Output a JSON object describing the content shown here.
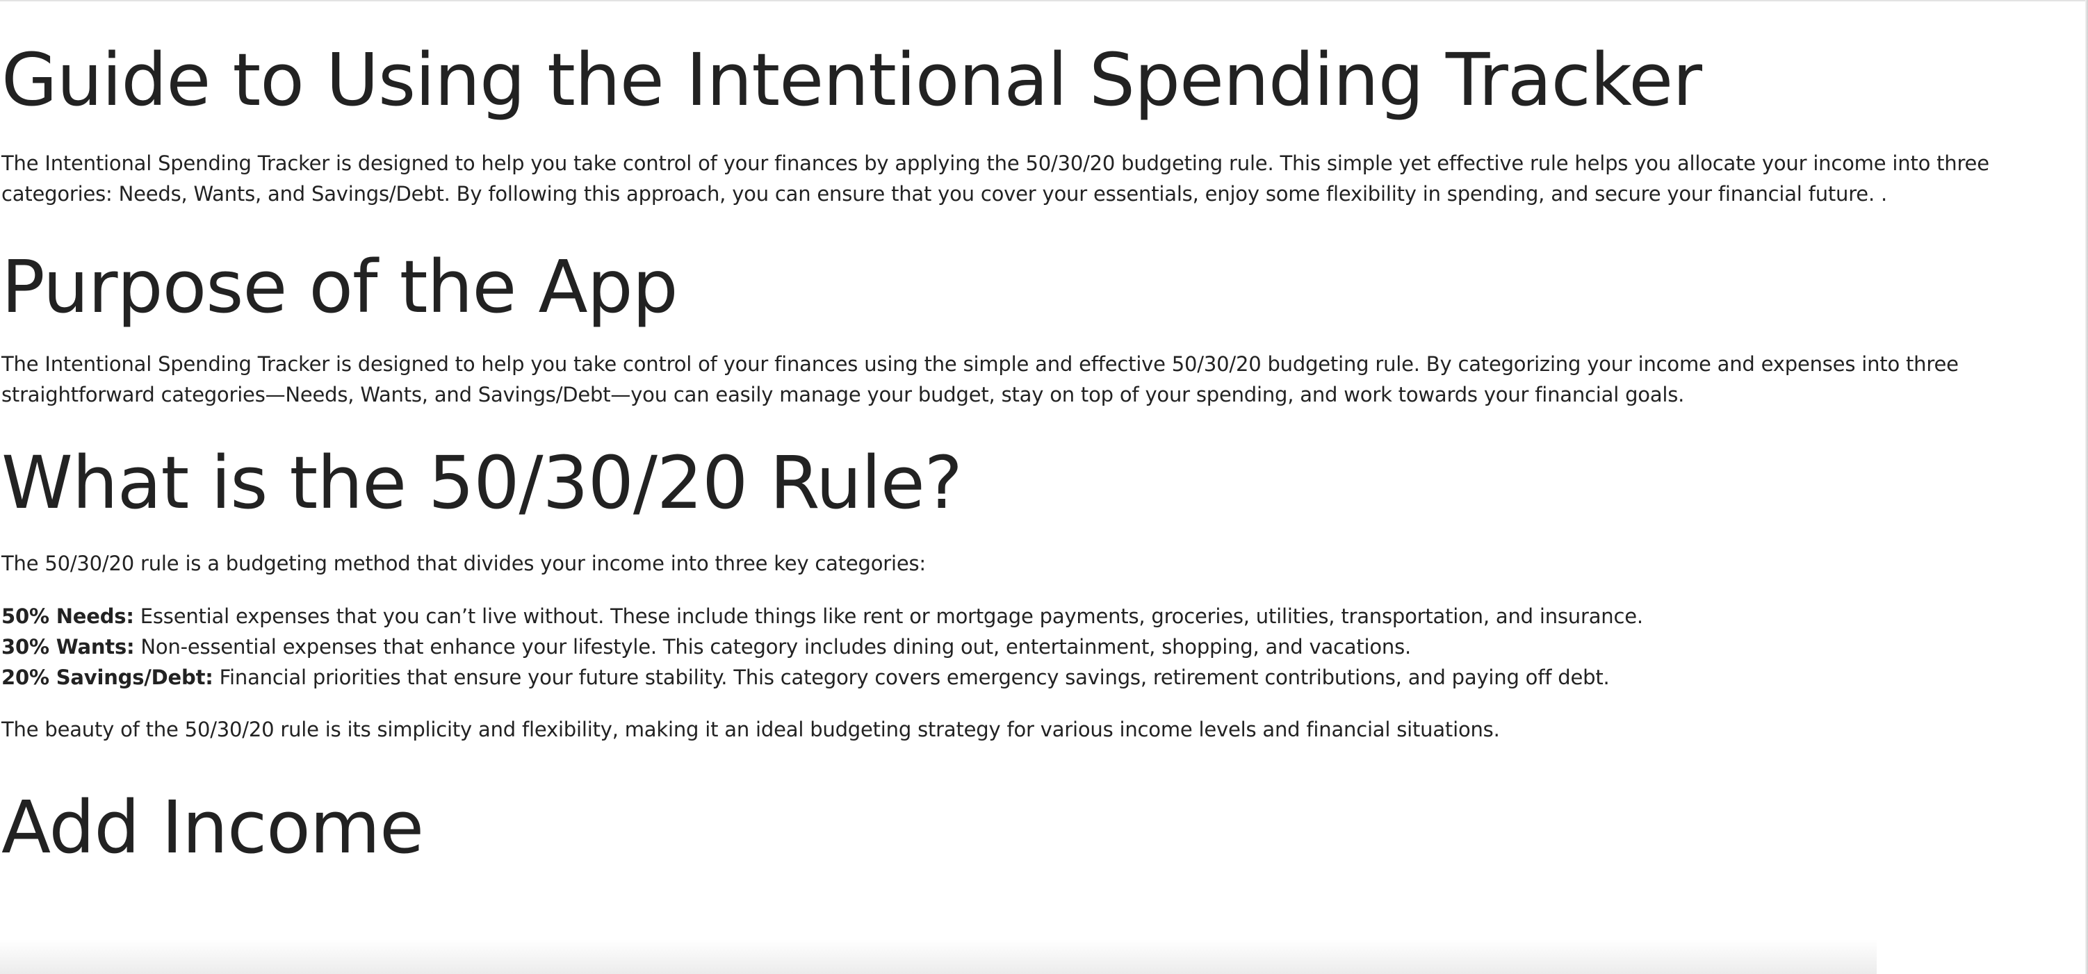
{
  "sections": [
    {
      "title": "Guide to Using the Intentional Spending Tracker",
      "paragraph": "The Intentional Spending Tracker is designed to help you take control of your finances by applying the 50/30/20 budgeting rule. This simple yet effective rule helps you allocate your income into three categories: Needs, Wants, and Savings/Debt. By following this approach, you can ensure that you cover your essentials, enjoy some flexibility in spending, and secure your financial future. ."
    },
    {
      "title": "Purpose of the App",
      "paragraph": "The Intentional Spending Tracker is designed to help you take control of your finances using the simple and effective 50/30/20 budgeting rule. By categorizing your income and expenses into three straightforward categories—Needs, Wants, and Savings/Debt—you can easily manage your budget, stay on top of your spending, and work towards your financial goals."
    },
    {
      "title": "What is the 50/30/20 Rule?",
      "intro": "The 50/30/20 rule is a budgeting method that divides your income into three key categories:",
      "rules": [
        {
          "label": "50% Needs:",
          "text": " Essential expenses that you can’t live without. These include things like rent or mortgage payments, groceries, utilities, transportation, and insurance."
        },
        {
          "label": "30% Wants:",
          "text": " Non-essential expenses that enhance your lifestyle. This category includes dining out, entertainment, shopping, and vacations."
        },
        {
          "label": "20% Savings/Debt:",
          "text": " Financial priorities that ensure your future stability. This category covers emergency savings, retirement contributions, and paying off debt."
        }
      ],
      "closing": "The beauty of the 50/30/20 rule is its simplicity and flexibility, making it an ideal budgeting strategy for various income levels and financial situations."
    },
    {
      "title": "Add Income"
    }
  ]
}
